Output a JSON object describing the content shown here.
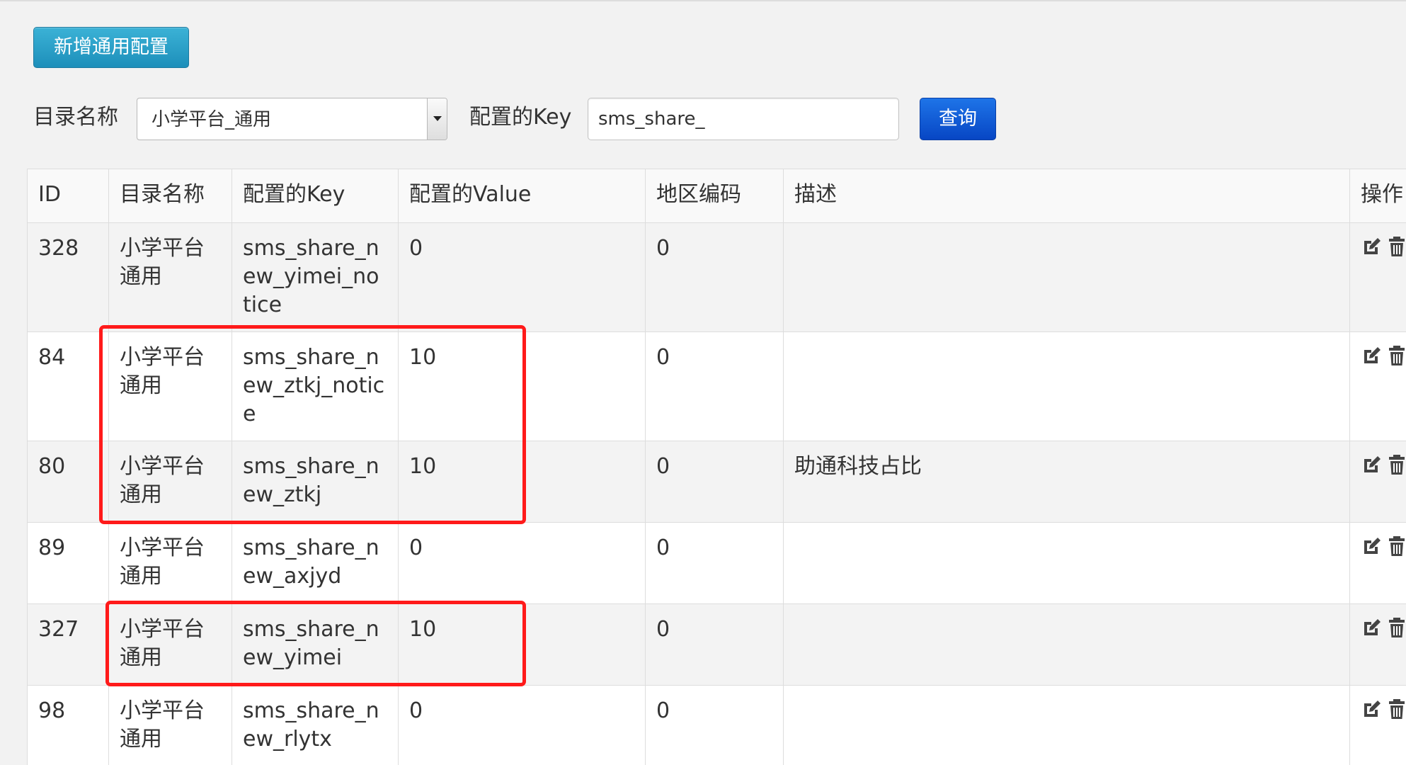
{
  "toolbar": {
    "add_label": "新增通用配置"
  },
  "filters": {
    "dir_label": "目录名称",
    "dir_value": "小学平台_通用",
    "key_label": "配置的Key",
    "key_value": "sms_share_",
    "query_label": "查询"
  },
  "table": {
    "headers": {
      "id": "ID",
      "dir": "目录名称",
      "key": "配置的Key",
      "value": "配置的Value",
      "region": "地区编码",
      "desc": "描述",
      "action": "操作"
    },
    "rows": [
      {
        "id": "328",
        "dir": "小学平台通用",
        "key": "sms_share_new_yimei_notice",
        "value": "0",
        "region": "0",
        "desc": ""
      },
      {
        "id": "84",
        "dir": "小学平台通用",
        "key": "sms_share_new_ztkj_notice",
        "value": "10",
        "region": "0",
        "desc": ""
      },
      {
        "id": "80",
        "dir": "小学平台通用",
        "key": "sms_share_new_ztkj",
        "value": "10",
        "region": "0",
        "desc": "助通科技占比"
      },
      {
        "id": "89",
        "dir": "小学平台通用",
        "key": "sms_share_new_axjyd",
        "value": "0",
        "region": "0",
        "desc": ""
      },
      {
        "id": "327",
        "dir": "小学平台通用",
        "key": "sms_share_new_yimei",
        "value": "10",
        "region": "0",
        "desc": ""
      },
      {
        "id": "98",
        "dir": "小学平台通用",
        "key": "sms_share_new_rlytx",
        "value": "0",
        "region": "0",
        "desc": ""
      }
    ],
    "action_icons": [
      "edit-icon",
      "trash-icon"
    ]
  },
  "colors": {
    "add_button": "#2aa3cc",
    "query_button": "#0b55d6",
    "highlight": "#ff1a1a",
    "row_stripe": "#f3f3f3"
  }
}
